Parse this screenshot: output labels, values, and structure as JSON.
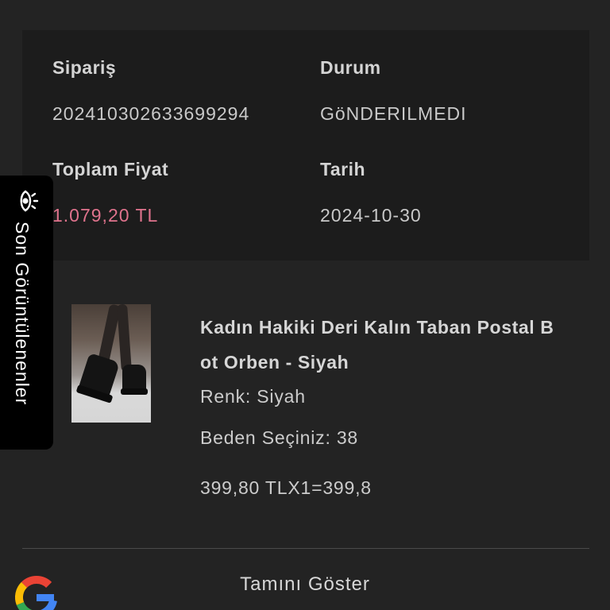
{
  "order": {
    "order_label": "Sipariş",
    "order_number": "202410302633699294",
    "status_label": "Durum",
    "status_value": "GöNDERILMEDI",
    "total_label": "Toplam Fiyat",
    "total_value": "1.079,20 TL",
    "date_label": "Tarih",
    "date_value": "2024-10-30"
  },
  "product": {
    "title": "Kadın Hakiki Deri Kalın Taban Postal Bot Orben - Siyah",
    "color": "Renk: Siyah",
    "size": "Beden Seçiniz: 38",
    "price_line": "399,80 TLX1=399,8"
  },
  "footer": {
    "show_all": "Tamını Göster"
  },
  "recent_tab": {
    "label": "Son Görüntülenenler",
    "icon": "eye-icon"
  },
  "colors": {
    "background": "#232323",
    "card": "#1c1c1c",
    "price": "#e0738d"
  }
}
